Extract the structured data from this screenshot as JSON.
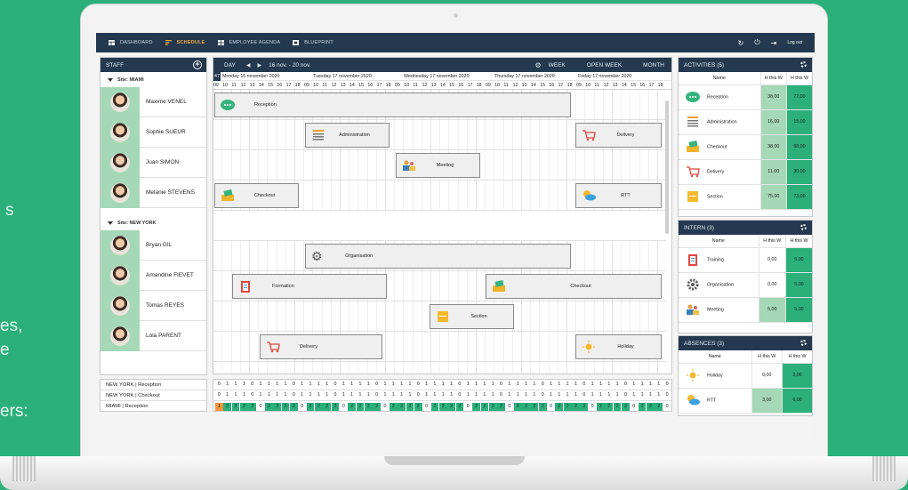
{
  "background_text": {
    "line1": "s",
    "line2": "es,",
    "line3": "e",
    "line4": "ers:"
  },
  "nav": {
    "items": [
      {
        "label": "DASHBOARD",
        "icon": "dashboard-icon"
      },
      {
        "label": "SCHEDULE",
        "icon": "schedule-icon"
      },
      {
        "label": "EMPLOYEE AGENDA",
        "icon": "agenda-icon"
      },
      {
        "label": "BLUEPRINT",
        "icon": "blueprint-icon"
      }
    ],
    "logout": "Log out"
  },
  "staff": {
    "title": "STAFF",
    "sites": [
      {
        "name": "Site: MIAMI",
        "members": [
          "Maxime VENEL",
          "Sophie SUEUR",
          "Juan SIMON",
          "Melanie STEVENS"
        ]
      },
      {
        "name": "Site: NEW YORK",
        "members": [
          "Bryan GIL",
          "Amandine FIEVET",
          "Tomas REYES",
          "Lola PARENT"
        ]
      }
    ]
  },
  "schedule": {
    "view": "DAY",
    "range": "16 nov. - 20 nov.",
    "week_btn": "WEEK",
    "open_week_btn": "OPEN WEEK",
    "month_btn": "MONTH",
    "week_number": "47",
    "days": [
      "Monday 16 november 2020",
      "Tuesday 17 november 2020",
      "Wednesday 17 november 2020",
      "Thursday 17 november 2020",
      "Friday 17 november 2020"
    ],
    "hours": [
      "09",
      "10",
      "11",
      "12",
      "13",
      "14",
      "15",
      "16",
      "17",
      "18"
    ],
    "events": [
      {
        "label": "Reception",
        "icon": "chat-icon"
      },
      {
        "label": "Administration",
        "icon": "documents-icon"
      },
      {
        "label": "Delivery",
        "icon": "cart-icon"
      },
      {
        "label": "Meeting",
        "icon": "meeting-icon"
      },
      {
        "label": "Checkout",
        "icon": "cash-icon"
      },
      {
        "label": "RTT",
        "icon": "weather-icon"
      },
      {
        "label": "Organisation",
        "icon": "gear-icon"
      },
      {
        "label": "Formation",
        "icon": "clipboard-icon"
      },
      {
        "label": "Checkout",
        "icon": "cash-icon"
      },
      {
        "label": "Section",
        "icon": "section-icon"
      },
      {
        "label": "Delivery",
        "icon": "cart-icon"
      },
      {
        "label": "Holiday",
        "icon": "sun-icon"
      }
    ]
  },
  "coverage": {
    "rows": [
      {
        "label": "NEW YORK  |  Reception",
        "cells": "0111011110111101111011110111101111011110111101111011110"
      },
      {
        "label": "NEW YORK  |  Checkout",
        "cells": "0111011110111101111011110111101111011110111101111011110"
      },
      {
        "label": "MIAMI  |  Reception",
        "cells": "1222202222022220222202222022220222202222022220222202220"
      }
    ]
  },
  "activities": {
    "title": "ACTIVITIES (5)",
    "columns": [
      "Name",
      "H this W",
      "H this W"
    ],
    "rows": [
      {
        "name": "Reception",
        "icon": "chat-icon",
        "a": "38,00",
        "b": "77,00"
      },
      {
        "name": "Administration",
        "icon": "documents-icon",
        "a": "16,00",
        "b": "15,00"
      },
      {
        "name": "Checkout",
        "icon": "cash-icon",
        "a": "38,00",
        "b": "68,00"
      },
      {
        "name": "Delivery",
        "icon": "cart-icon",
        "a": "11,00",
        "b": "30,00"
      },
      {
        "name": "Section",
        "icon": "section-icon",
        "a": "75,00",
        "b": "73,00"
      }
    ]
  },
  "intern": {
    "title": "INTERN (3)",
    "columns": [
      "Name",
      "H this W",
      "H this W"
    ],
    "rows": [
      {
        "name": "Training",
        "icon": "clipboard-icon",
        "a": "0,00",
        "b": "5,00"
      },
      {
        "name": "Organisation",
        "icon": "gear-icon",
        "a": "0,00",
        "b": "5,00"
      },
      {
        "name": "Meeting",
        "icon": "meeting-icon",
        "a": "5,00",
        "b": "5,00"
      }
    ]
  },
  "absences": {
    "title": "ABSENCES (3)",
    "columns": [
      "Name",
      "H this W",
      "H this W"
    ],
    "rows": [
      {
        "name": "Holiday",
        "icon": "sun-icon",
        "a": "0,00",
        "b": "3,00"
      },
      {
        "name": "RTT",
        "icon": "weather-icon",
        "a": "3,00",
        "b": "6,00"
      }
    ]
  },
  "colors": {
    "navy": "#24394f",
    "green": "#2bb07a",
    "light_green": "#a5d8b6",
    "orange": "#f0953a"
  }
}
